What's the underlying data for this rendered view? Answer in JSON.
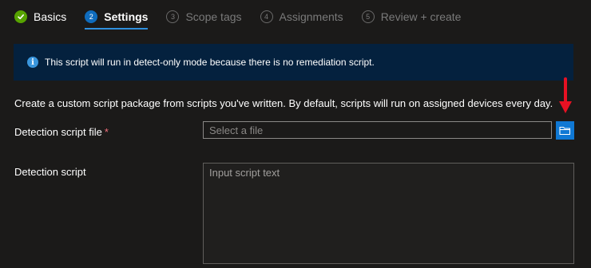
{
  "steps": [
    {
      "number": "",
      "label": "Basics",
      "state": "done"
    },
    {
      "number": "2",
      "label": "Settings",
      "state": "active"
    },
    {
      "number": "3",
      "label": "Scope tags",
      "state": "pending"
    },
    {
      "number": "4",
      "label": "Assignments",
      "state": "pending"
    },
    {
      "number": "5",
      "label": "Review + create",
      "state": "pending"
    }
  ],
  "banner": {
    "icon": "info-icon",
    "text": "This script will run in detect-only mode because there is no remediation script."
  },
  "description": "Create a custom script package from scripts you've written. By default, scripts will run on assigned devices every day.",
  "detection_file": {
    "label": "Detection script file",
    "required_marker": "*",
    "placeholder": "Select a file",
    "value": "",
    "button_icon": "folder-open-icon"
  },
  "detection_script": {
    "label": "Detection script",
    "placeholder": "Input script text",
    "value": ""
  },
  "colors": {
    "background": "#1b1a19",
    "accent": "#0f6cbd",
    "success": "#57a300",
    "banner": "#04213e",
    "required": "#f1707b",
    "annotation_arrow": "#e81123"
  }
}
